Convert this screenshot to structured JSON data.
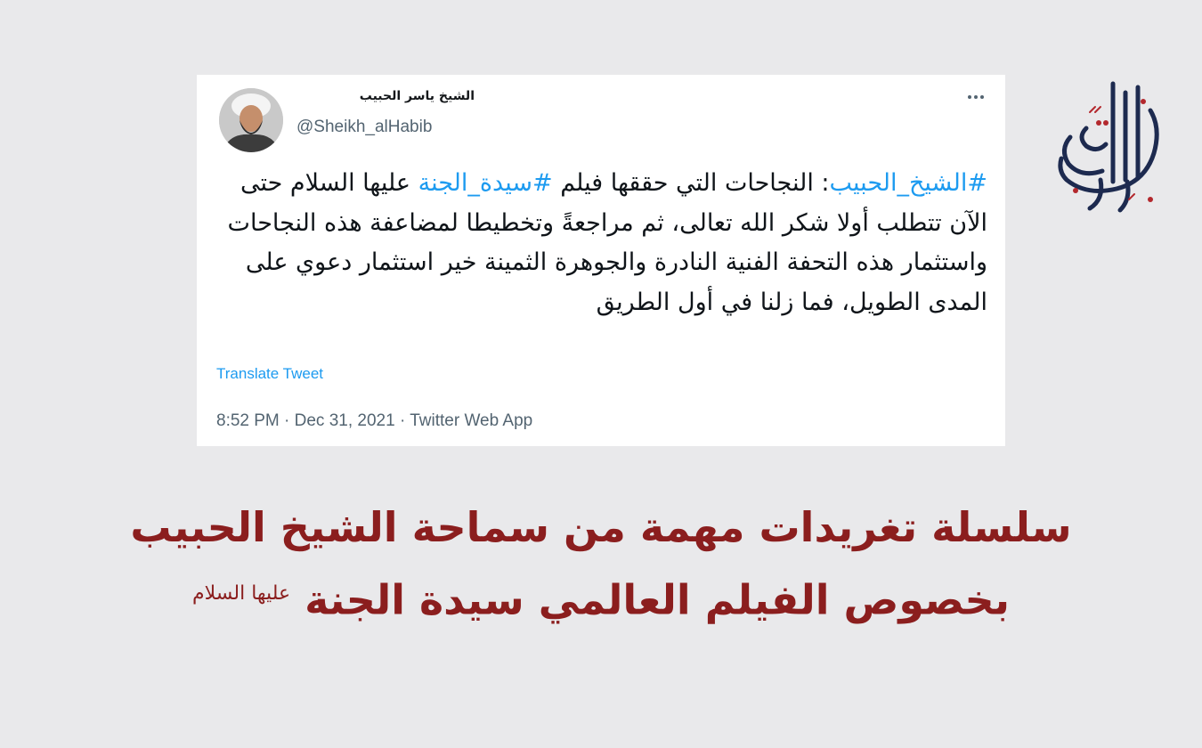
{
  "tweet": {
    "author_name": "الشيخ ياسر الحبيب",
    "author_handle": "@Sheikh_alHabib",
    "text": {
      "hashtag_1": "#الشيخ_الحبيب",
      "part_1": ": النجاحات التي حققها فيلم ",
      "hashtag_2": "#سيدة_الجنة",
      "part_2": " عليها السلام حتى الآن تتطلب أولا شكر الله تعالى، ثم مراجعةً وتخطيطا لمضاعفة هذه النجاحات واستثمار هذه التحفة الفنية النادرة والجوهرة الثمينة خير استثمار دعوي على المدى الطويل، فما زلنا في أول الطريق"
    },
    "translate_label": "Translate Tweet",
    "meta": "8:52 PM · Dec 31, 2021 · Twitter Web App"
  },
  "headline": {
    "line_1": "سلسلة تغريدات مهمة من سماحة الشيخ الحبيب",
    "line_2": "بخصوص الفيلم العالمي سيدة الجنة",
    "honorific": "عليها السلام"
  },
  "logo": {
    "text": "لبيك يا فاطمة",
    "colors": {
      "navy": "#1d2a4f",
      "red": "#b3282d"
    }
  },
  "colors": {
    "background": "#e9e9eb",
    "hashtag": "#1d9bf0",
    "headline": "#8b1e1e",
    "meta": "#536471"
  }
}
